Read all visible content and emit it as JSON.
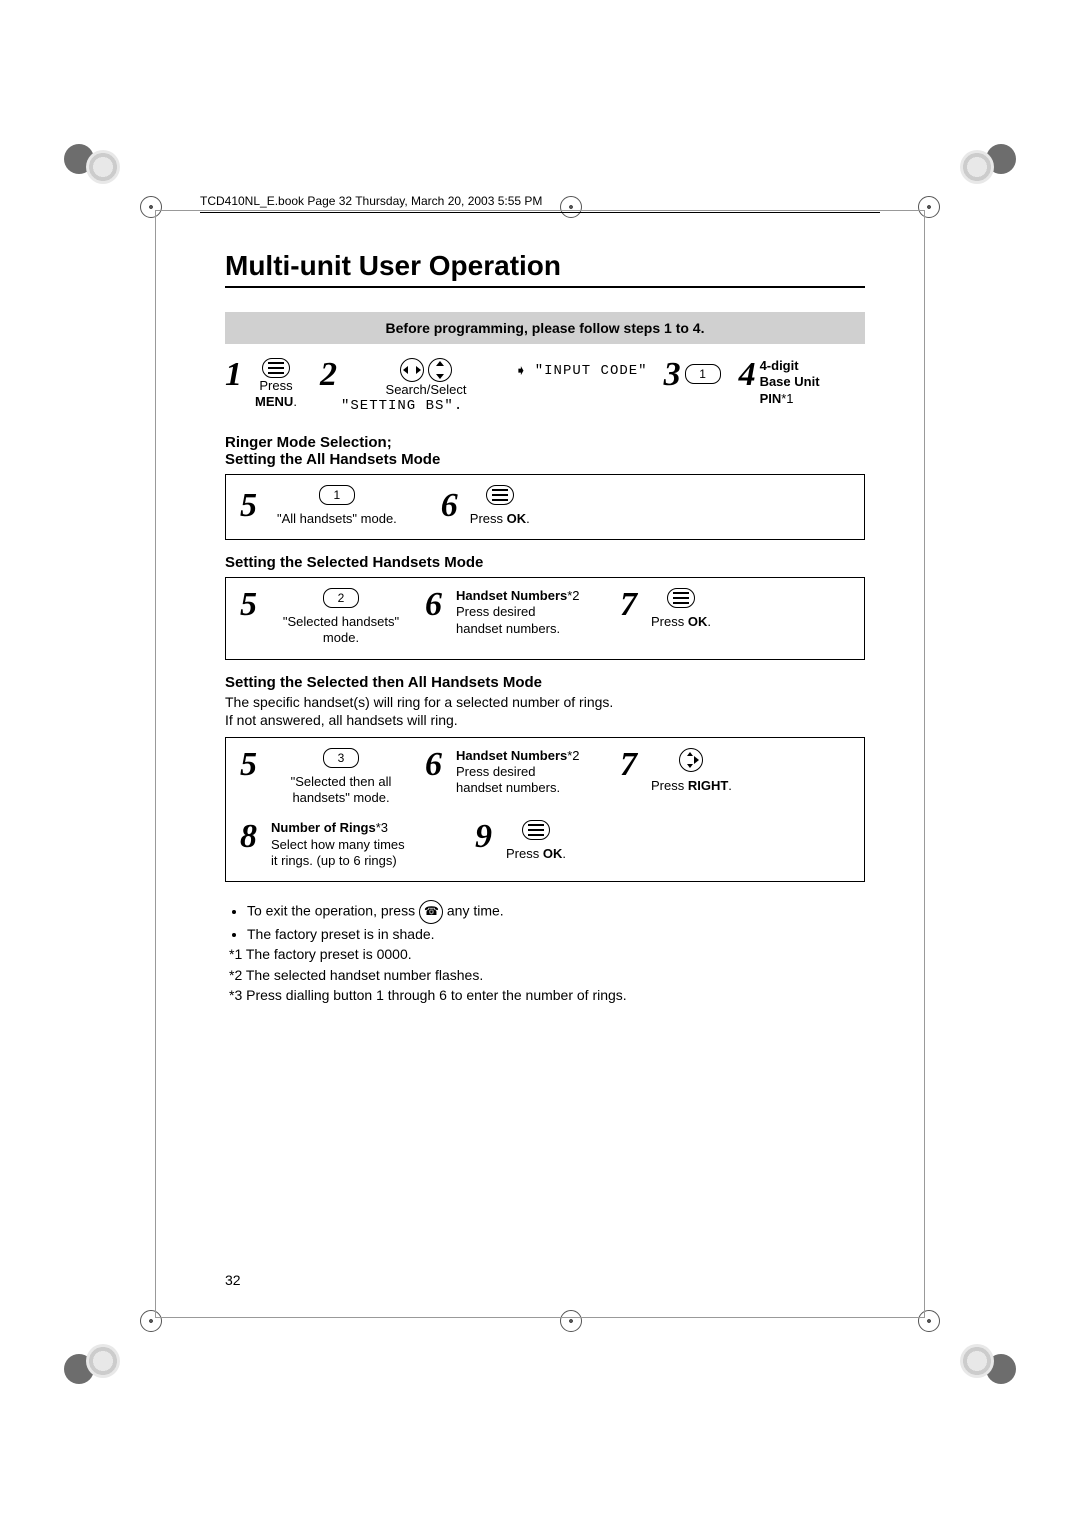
{
  "running_head": "TCD410NL_E.book  Page 32  Thursday, March 20, 2003  5:55 PM",
  "title": "Multi-unit User Operation",
  "banner": "Before programming, please follow steps 1 to 4.",
  "preset_steps": {
    "s1": {
      "num": "1",
      "label": "Press",
      "bold": "MENU",
      "suffix": "."
    },
    "s2": {
      "num": "2",
      "label": "Search/Select",
      "mono": "\"SETTING BS\"."
    },
    "pointer": "➧",
    "s2_display": "\"INPUT CODE\"",
    "s3": {
      "num": "3",
      "pill": "1"
    },
    "s4": {
      "num": "4",
      "line1": "4-digit",
      "line2": "Base Unit",
      "line3a": "PIN",
      "line3b": "*1"
    }
  },
  "section_a": {
    "head1": "Ringer Mode Selection;",
    "head2": "Setting the All Handsets Mode",
    "s5": {
      "num": "5",
      "pill": "1",
      "label": "\"All handsets\" mode."
    },
    "s6": {
      "num": "6",
      "label": "Press ",
      "bold": "OK",
      "suffix": "."
    }
  },
  "section_b": {
    "head": "Setting the Selected Handsets Mode",
    "s5": {
      "num": "5",
      "pill": "2",
      "l1": "\"Selected handsets\"",
      "l2": "mode."
    },
    "s6": {
      "num": "6",
      "head": "Handset Numbers",
      "sup": "*2",
      "l1": "Press desired",
      "l2": "handset numbers."
    },
    "s7": {
      "num": "7",
      "label": "Press ",
      "bold": "OK",
      "suffix": "."
    }
  },
  "section_c": {
    "head": "Setting the Selected then All Handsets Mode",
    "desc1": "The specific handset(s) will ring for a selected number of rings.",
    "desc2": "If not answered, all handsets will ring.",
    "s5": {
      "num": "5",
      "pill": "3",
      "l1": "\"Selected then all",
      "l2": "handsets\" mode."
    },
    "s6": {
      "num": "6",
      "head": "Handset Numbers",
      "sup": "*2",
      "l1": "Press desired",
      "l2": "handset numbers."
    },
    "s7": {
      "num": "7",
      "label": "Press ",
      "bold": "RIGHT",
      "suffix": "."
    },
    "s8": {
      "num": "8",
      "head": "Number of Rings",
      "sup": "*3",
      "l1": "Select how many times",
      "l2": "it rings. (up to 6 rings)"
    },
    "s9": {
      "num": "9",
      "label": "Press ",
      "bold": "OK",
      "suffix": "."
    }
  },
  "notes": {
    "n1a": "To exit the operation, press ",
    "n1b": " any time.",
    "n2": "The factory preset is in shade.",
    "n3": "*1 The factory preset is 0000.",
    "n4": "*2 The selected handset number flashes.",
    "n5": "*3 Press dialling button 1 through 6 to enter the number of rings."
  },
  "page_num": "32"
}
